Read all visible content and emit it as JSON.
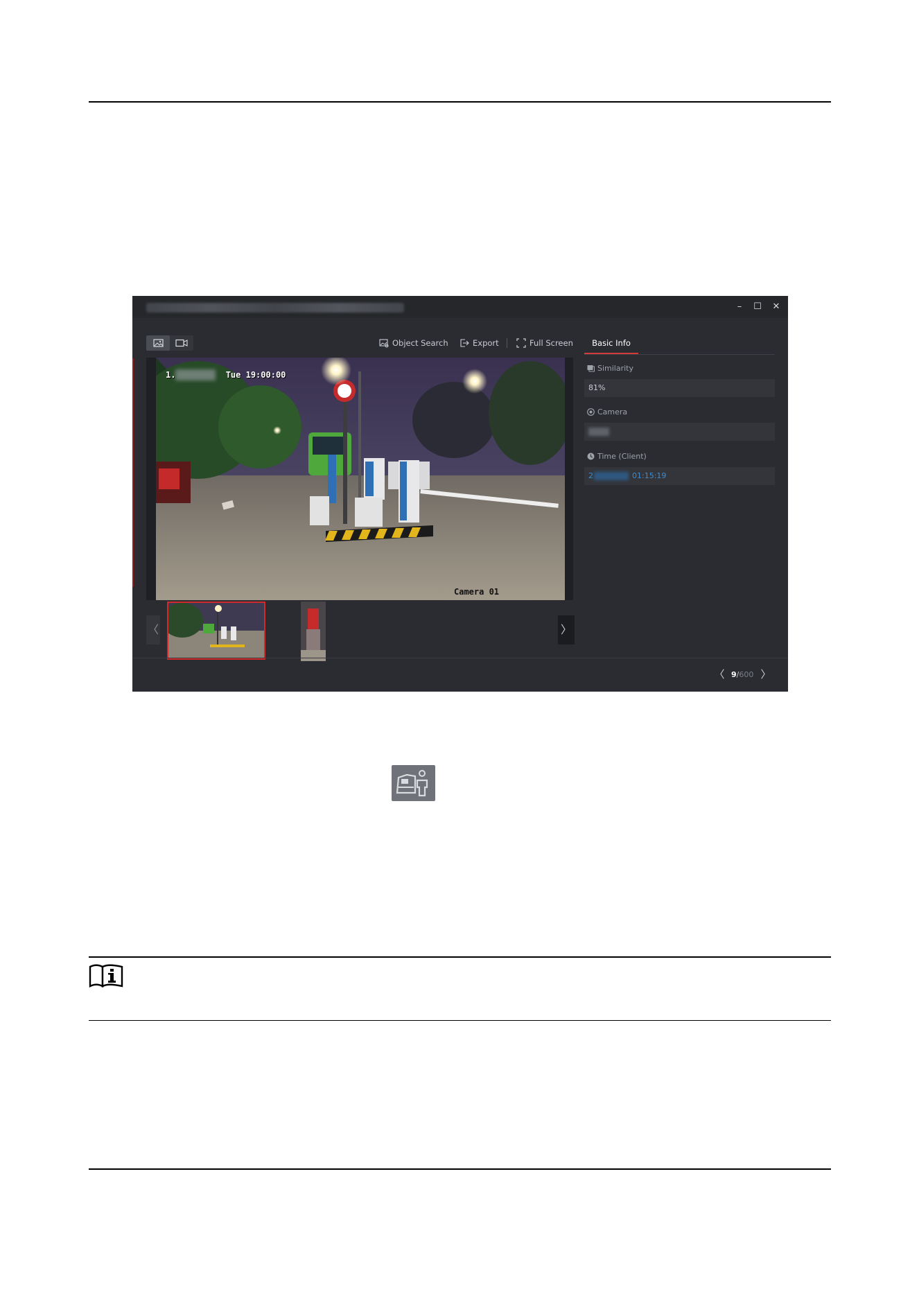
{
  "app": {
    "window_controls": {
      "minimize": "–",
      "maximize": "☐",
      "close": "✕"
    },
    "toolbar": {
      "object_search": "Object Search",
      "export": "Export",
      "full_screen": "Full Screen"
    },
    "tabs": {
      "basic_info": "Basic Info"
    },
    "info": {
      "similarity_label": "Similarity",
      "similarity_value": "81%",
      "camera_label": "Camera",
      "camera_value": "",
      "time_label": "Time (Client)",
      "time_value_prefix": "2",
      "time_value_suffix": "01:15:19"
    },
    "video": {
      "osd_time_prefix": "1.",
      "osd_time": "Tue 19:00:00",
      "osd_camera": "Camera 01"
    },
    "thumb_nav": {
      "prev": "〈",
      "next": "〉"
    },
    "pagination": {
      "prev": "〈",
      "current": "9",
      "separator": "/",
      "total": "600",
      "next": "〉"
    }
  },
  "icons": [
    "image-mode-icon",
    "video-mode-icon",
    "object-search-icon",
    "export-icon",
    "full-screen-icon",
    "similarity-icon",
    "camera-icon",
    "clock-icon",
    "person-vehicle-icon",
    "note-icon"
  ],
  "colors": {
    "accent_red": "#d33b3b",
    "time_blue": "#3b8fd6",
    "app_bg": "#2a2c31"
  }
}
